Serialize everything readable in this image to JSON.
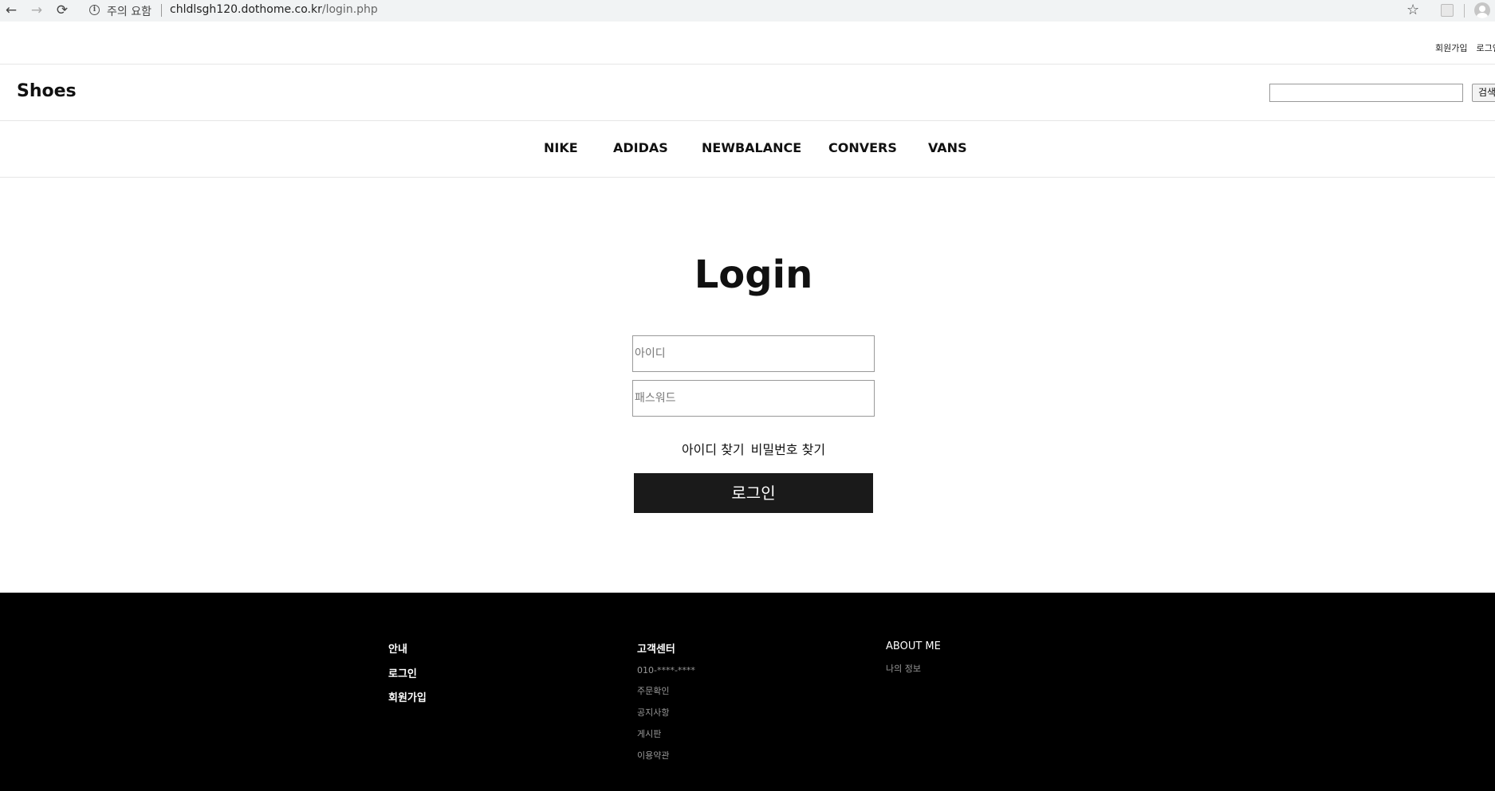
{
  "browser": {
    "security_label": "주의 요함",
    "url_host": "chldlsgh120.dothome.co.kr",
    "url_path": "/login.php",
    "icons": [
      "back-arrow-icon",
      "forward-arrow-icon",
      "reload-icon",
      "info-icon",
      "star-icon",
      "extension-icon",
      "profile-icon"
    ]
  },
  "topnav": {
    "signup": "회원가입",
    "login": "로그인"
  },
  "header": {
    "logo": "Shoes",
    "search_placeholder": "",
    "search_button": "검색"
  },
  "categories": [
    "NIKE",
    "ADIDAS",
    "NEWBALANCE",
    "CONVERS",
    "VANS"
  ],
  "login": {
    "title": "Login",
    "id_placeholder": "아이디",
    "password_placeholder": "패스워드",
    "find_id": "아이디 찾기",
    "find_password": "비밀번호 찾기",
    "submit": "로그인"
  },
  "footer": {
    "col1": {
      "heading": "안내",
      "items": [
        "로그인",
        "회원가입"
      ]
    },
    "col2": {
      "heading": "고객센터",
      "items": [
        "010-****-****",
        "주문확인",
        "공지사항",
        "게시판",
        "이용약관"
      ]
    },
    "col3": {
      "heading": "ABOUT ME",
      "items": [
        "나의 정보"
      ]
    }
  },
  "colors": {
    "login_button": "#1a1a1a",
    "footer_bg": "#000000",
    "footer_muted_text": "#999999"
  }
}
